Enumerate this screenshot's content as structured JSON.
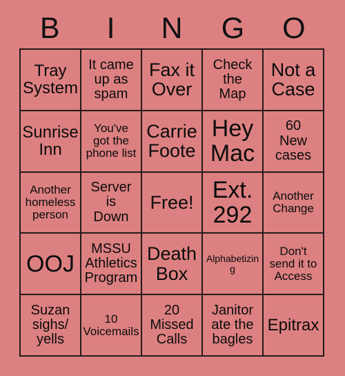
{
  "card": {
    "title": "BINGO",
    "header_letters": [
      "B",
      "I",
      "N",
      "G",
      "O"
    ],
    "background_color": "#dd8081",
    "border_color": "#231b1b",
    "text_color": "#0c0c0c",
    "rows": 5,
    "columns": 5,
    "cells": [
      {
        "text": "Tray\nSystem",
        "size": "lg"
      },
      {
        "text": "It came\nup as\nspam",
        "size": "md"
      },
      {
        "text": "Fax it\nOver",
        "size": "xl"
      },
      {
        "text": "Check\nthe\nMap",
        "size": "md"
      },
      {
        "text": "Not a\nCase",
        "size": "xl"
      },
      {
        "text": "Sunrise\nInn",
        "size": "lg"
      },
      {
        "text": "You've\ngot the\nphone list",
        "size": "sm"
      },
      {
        "text": "Carrie\nFoote",
        "size": "xl"
      },
      {
        "text": "Hey\nMac",
        "size": "xxl"
      },
      {
        "text": "60\nNew\ncases",
        "size": "md"
      },
      {
        "text": "Another\nhomeless\nperson",
        "size": "sm"
      },
      {
        "text": "Server\nis\nDown",
        "size": "md"
      },
      {
        "text": "Free!",
        "size": "xl"
      },
      {
        "text": "Ext.\n292",
        "size": "xxl"
      },
      {
        "text": "Another\nChange",
        "size": "sm"
      },
      {
        "text": "OOJ",
        "size": "xxl"
      },
      {
        "text": "MSSU\nAthletics\nProgram",
        "size": "md"
      },
      {
        "text": "Death\nBox",
        "size": "xl"
      },
      {
        "text": "Alphabetizing",
        "size": "xs"
      },
      {
        "text": "Don't\nsend it to\nAccess",
        "size": "sm"
      },
      {
        "text": "Suzan\nsighs/\nyells",
        "size": "md"
      },
      {
        "text": "10\nVoicemails",
        "size": "sm"
      },
      {
        "text": "20\nMissed\nCalls",
        "size": "md"
      },
      {
        "text": "Janitor\nate the\nbagles",
        "size": "md"
      },
      {
        "text": "Epitrax",
        "size": "lg"
      }
    ]
  }
}
